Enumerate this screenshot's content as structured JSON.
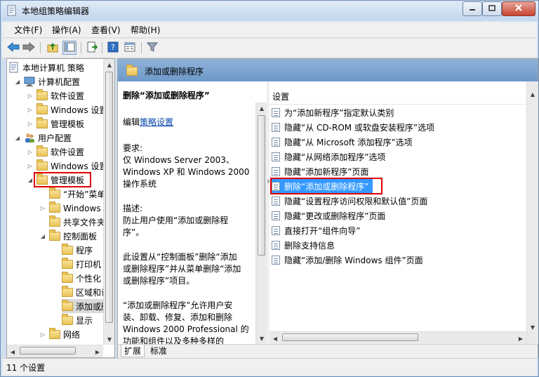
{
  "window": {
    "title": "本地组策略编辑器"
  },
  "menu": [
    "文件(F)",
    "操作(A)",
    "查看(V)",
    "帮助(H)"
  ],
  "tree": {
    "items": [
      "本地计算机 策略",
      "计算机配置",
      "软件设置",
      "Windows 设置",
      "管理模板",
      "用户配置",
      "软件设置",
      "Windows 设置",
      "管理模板",
      "“开始”菜单和任务栏",
      "Windows 组件",
      "共享文件夹",
      "控制面板",
      "程序",
      "打印机",
      "个性化",
      "区域和语言选项",
      "添加或删除程序",
      "显示",
      "网络"
    ]
  },
  "header": {
    "title": "添加或删除程序"
  },
  "description": {
    "title": "删除“添加或删除程序”",
    "edit_prefix": "编辑",
    "edit_link": "策略设置",
    "req_label": "要求:",
    "req_lines": [
      "仅 Windows Server 2003、",
      "Windows XP 和 Windows 2000",
      "操作系统"
    ],
    "desc_label": "描述:",
    "desc_lines": [
      "防止用户使用“添加或删除程",
      "序”。"
    ],
    "para_lines": [
      "此设置从“控制面板”删除“添加",
      "或删除程序”并从菜单删除“添加",
      "或删除程序”项目。"
    ],
    "para2_lines": [
      "“添加或删除程序”允许用户安",
      "装、卸载、修复、添加和删除",
      "Windows 2000 Professional 的",
      "功能和组件以及多种多样的"
    ]
  },
  "list": {
    "column": "设置",
    "items": [
      "为“添加新程序”指定默认类别",
      "隐藏“从 CD-ROM 或软盘安装程序”选项",
      "隐藏“从 Microsoft 添加程序”选项",
      "隐藏“从网络添加程序”选项",
      "隐藏“添加新程序”页面",
      "删除“添加或删除程序”",
      "隐藏“设置程序访问权限和默认值”页面",
      "隐藏“更改或删除程序”页面",
      "直接打开“组件向导”",
      "删除支持信息",
      "隐藏“添加/删除 Windows 组件”页面"
    ]
  },
  "tabs": [
    "扩展",
    "标准"
  ],
  "status": {
    "text": "11 个设置"
  }
}
